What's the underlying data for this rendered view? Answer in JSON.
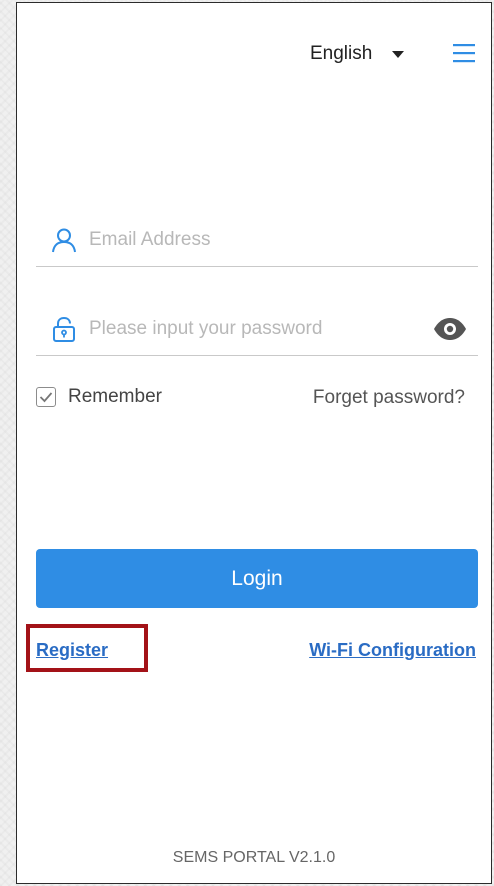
{
  "header": {
    "language": "English",
    "icons": {
      "dropdown": "caret-down-icon",
      "menu": "hamburger-menu-icon"
    }
  },
  "login_form": {
    "email": {
      "placeholder": "Email Address",
      "value": "",
      "icon": "user-icon"
    },
    "password": {
      "placeholder": "Please input your password",
      "value": "",
      "icon": "lock-icon",
      "toggle_icon": "eye-icon"
    },
    "remember_label": "Remember",
    "remember_checked": true,
    "forget_password_label": "Forget password?",
    "login_label": "Login"
  },
  "links": {
    "register": "Register",
    "wifi_configuration": "Wi-Fi Configuration"
  },
  "footer": {
    "version": "SEMS PORTAL V2.1.0"
  },
  "colors": {
    "accent": "#2f8de4",
    "link": "#2a6cc4",
    "highlight_box": "#a31218"
  }
}
